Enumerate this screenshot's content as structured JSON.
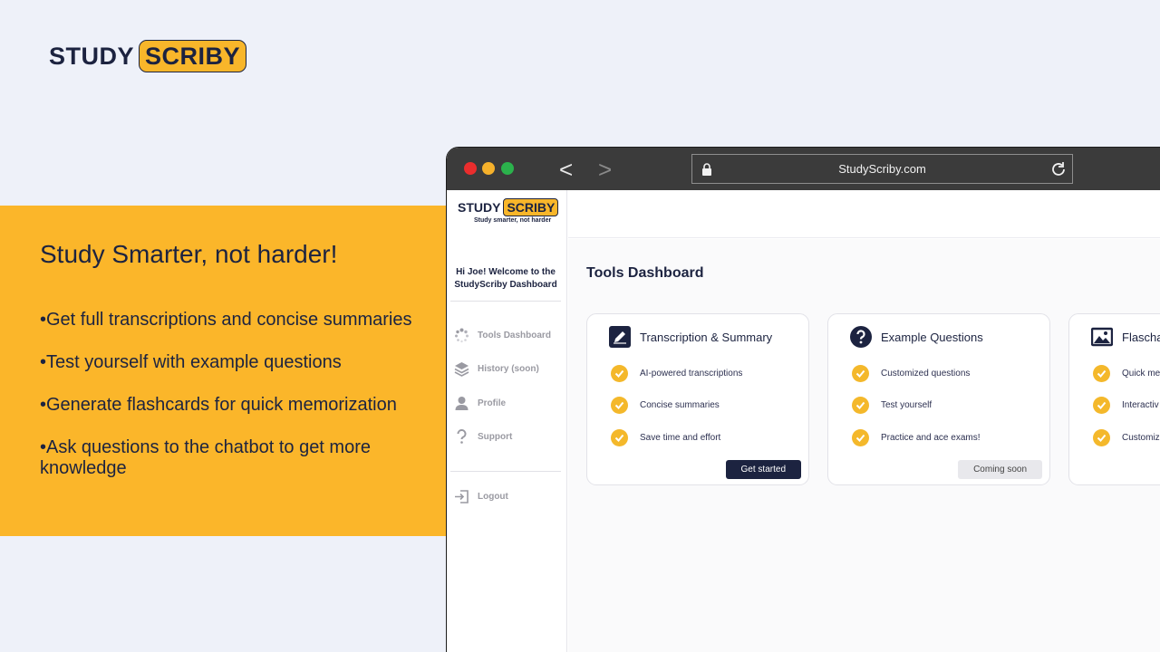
{
  "brand": {
    "logo_part1": "STUDY",
    "logo_part2": "SCRIBY",
    "tagline": "Study smarter, not harder"
  },
  "promo": {
    "headline": "Study Smarter, not harder!",
    "bullets": [
      "•Get full transcriptions and concise summaries",
      "•Test yourself with example questions",
      "•Generate flashcards for quick memorization",
      "•Ask questions to the chatbot to get more knowledge"
    ]
  },
  "browser": {
    "url": "StudyScriby.com",
    "back_label": "<",
    "forward_label": ">"
  },
  "sidebar": {
    "welcome_line1": "Hi Joe! Welcome to the",
    "welcome_line2": "StudyScriby Dashboard",
    "items": [
      {
        "label": "Tools Dashboard",
        "icon": "spinner-icon"
      },
      {
        "label": "History (soon)",
        "icon": "layers-icon"
      },
      {
        "label": "Profile",
        "icon": "user-icon"
      },
      {
        "label": "Support",
        "icon": "question-icon"
      }
    ],
    "logout_label": "Logout"
  },
  "main": {
    "title": "Tools Dashboard",
    "cards": [
      {
        "title": "Transcription & Summary",
        "icon": "pencil-icon",
        "features": [
          "AI-powered transcriptions",
          "Concise summaries",
          "Save time and effort"
        ],
        "button": "Get started"
      },
      {
        "title": "Example Questions",
        "icon": "question-circle-icon",
        "features": [
          "Customized questions",
          "Test yourself",
          "Practice and ace exams!"
        ],
        "button": "Coming soon"
      },
      {
        "title": "Flascha",
        "icon": "image-icon",
        "features": [
          "Quick me",
          "Interactiv",
          "Customiz"
        ],
        "button": ""
      }
    ]
  },
  "colors": {
    "accent": "#fbb62a",
    "navy": "#1c2340",
    "background": "#eef1f9"
  }
}
